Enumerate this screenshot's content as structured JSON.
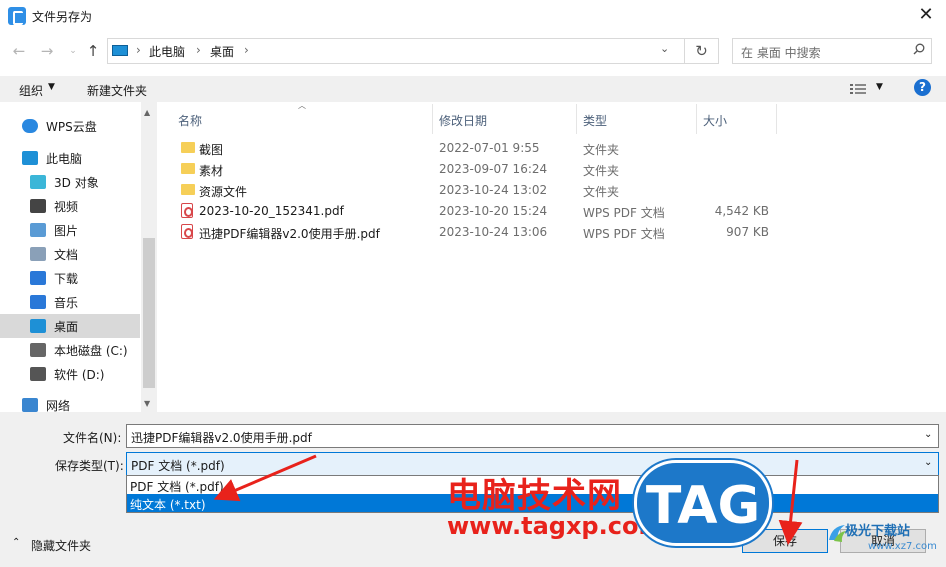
{
  "window": {
    "title": "文件另存为",
    "close": "✕"
  },
  "nav": {
    "back": "←",
    "forward": "→",
    "up": "↑",
    "recent": "⌄",
    "breadcrumb": [
      "此电脑",
      "桌面"
    ],
    "sep": "›",
    "refresh": "↻",
    "search_placeholder": "在 桌面 中搜索"
  },
  "toolbar": {
    "organize": "组织",
    "new_folder": "新建文件夹"
  },
  "sidebar": {
    "items": [
      {
        "label": "WPS云盘",
        "icon": "cloud-icon"
      },
      {
        "label": "此电脑",
        "icon": "computer-icon"
      },
      {
        "label": "3D 对象",
        "icon": "3d-objects-icon"
      },
      {
        "label": "视频",
        "icon": "video-icon"
      },
      {
        "label": "图片",
        "icon": "pictures-icon"
      },
      {
        "label": "文档",
        "icon": "documents-icon"
      },
      {
        "label": "下载",
        "icon": "download-icon"
      },
      {
        "label": "音乐",
        "icon": "music-icon"
      },
      {
        "label": "桌面",
        "icon": "desktop-icon",
        "selected": true
      },
      {
        "label": "本地磁盘 (C:)",
        "icon": "drive-c-icon"
      },
      {
        "label": "软件 (D:)",
        "icon": "drive-d-icon"
      },
      {
        "label": "网络",
        "icon": "network-icon"
      }
    ]
  },
  "columns": {
    "name": "名称",
    "modified": "修改日期",
    "type": "类型",
    "size": "大小"
  },
  "files": [
    {
      "name": "截图",
      "modified": "2022-07-01 9:55",
      "type": "文件夹",
      "size": "",
      "kind": "folder"
    },
    {
      "name": "素材",
      "modified": "2023-09-07 16:24",
      "type": "文件夹",
      "size": "",
      "kind": "folder"
    },
    {
      "name": "资源文件",
      "modified": "2023-10-24 13:02",
      "type": "文件夹",
      "size": "",
      "kind": "folder"
    },
    {
      "name": "2023-10-20_152341.pdf",
      "modified": "2023-10-20 15:24",
      "type": "WPS PDF 文档",
      "size": "4,542 KB",
      "kind": "pdf"
    },
    {
      "name": "迅捷PDF编辑器v2.0使用手册.pdf",
      "modified": "2023-10-24 13:06",
      "type": "WPS PDF 文档",
      "size": "907 KB",
      "kind": "pdf"
    }
  ],
  "form": {
    "filename_label": "文件名(N):",
    "filename_value": "迅捷PDF编辑器v2.0使用手册.pdf",
    "filetype_label": "保存类型(T):",
    "filetype_value": "PDF 文档 (*.pdf)",
    "filetype_options": [
      "PDF 文档 (*.pdf)",
      "纯文本 (*.txt)"
    ],
    "hide_folders": "隐藏文件夹",
    "save": "保存",
    "cancel": "取消"
  },
  "watermark": {
    "text": "电脑技术网",
    "url": "www.tagxp.com",
    "tag": "TAG",
    "site2": "极光下载站",
    "site2_url": "www.xz7.com"
  },
  "colors": {
    "accent": "#0078d7",
    "arrow": "#e8221b",
    "folder": "#f6cf58"
  }
}
